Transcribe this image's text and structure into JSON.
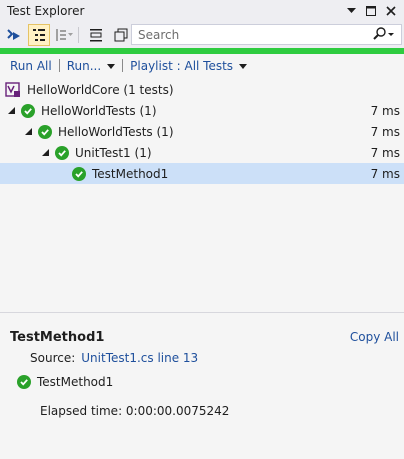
{
  "window": {
    "title": "Test Explorer",
    "buttons": [
      "dropdown-arrow",
      "maximize",
      "close"
    ]
  },
  "toolbar": {
    "search_placeholder": "Search",
    "icons": [
      "run-icon",
      "hierarchy-view-icon",
      "group-by-icon",
      "playlist-icon",
      "copy-icon"
    ]
  },
  "status_color": "#2ecc40",
  "actions": {
    "run_all": "Run All",
    "run": "Run...",
    "playlist": "Playlist : All Tests"
  },
  "tree": {
    "root": "HelloWorldCore (1 tests)",
    "rows": [
      {
        "label": "HelloWorldTests (1)",
        "time": "7 ms"
      },
      {
        "label": "HelloWorldTests (1)",
        "time": "7 ms"
      },
      {
        "label": "UnitTest1 (1)",
        "time": "7 ms"
      },
      {
        "label": "TestMethod1",
        "time": "7 ms"
      }
    ]
  },
  "details": {
    "title": "TestMethod1",
    "copy_all": "Copy All",
    "source_label": "Source:",
    "source_link": "UnitTest1.cs line 13",
    "result": "TestMethod1",
    "elapsed": "Elapsed time: 0:00:00.0075242"
  }
}
